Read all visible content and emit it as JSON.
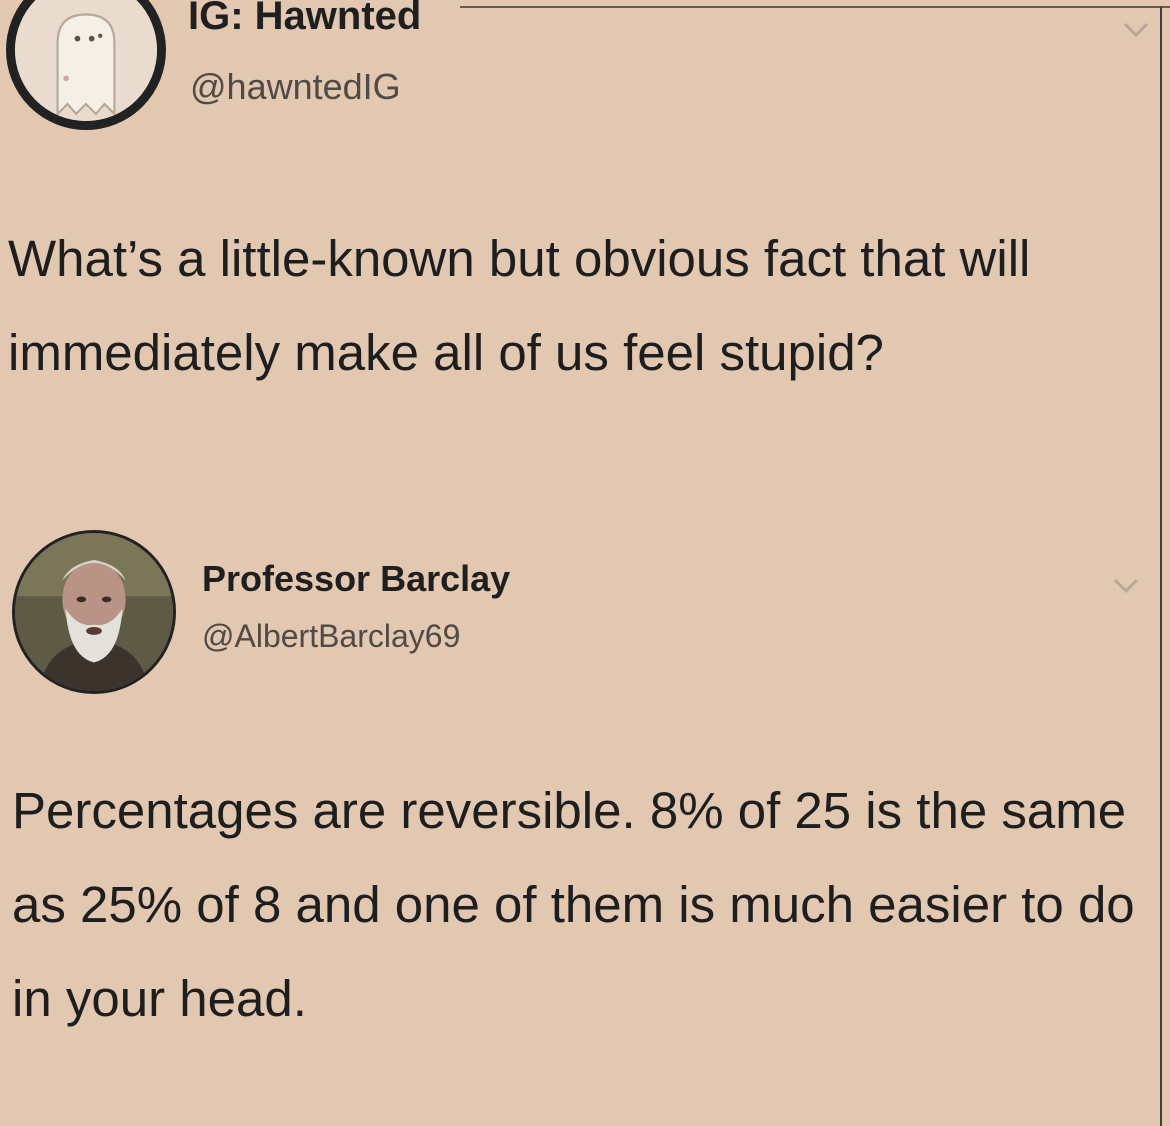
{
  "tweets": [
    {
      "display_name": "IG: Hawnted",
      "handle": "@hawntedIG",
      "avatar_icon": "ghost-icon",
      "text": "What’s a little-known but obvious fact that will immediately make all of us feel stupid?"
    },
    {
      "display_name": "Professor Barclay",
      "handle": "@AlbertBarclay69",
      "avatar_icon": "profile-photo",
      "text": "Percentages are reversible.  8% of 25 is the same as 25% of 8 and one of them is much easier to do in your head."
    }
  ],
  "colors": {
    "background": "#e2c8b1",
    "text": "#1e1e1e",
    "handle": "#4f4a45"
  }
}
